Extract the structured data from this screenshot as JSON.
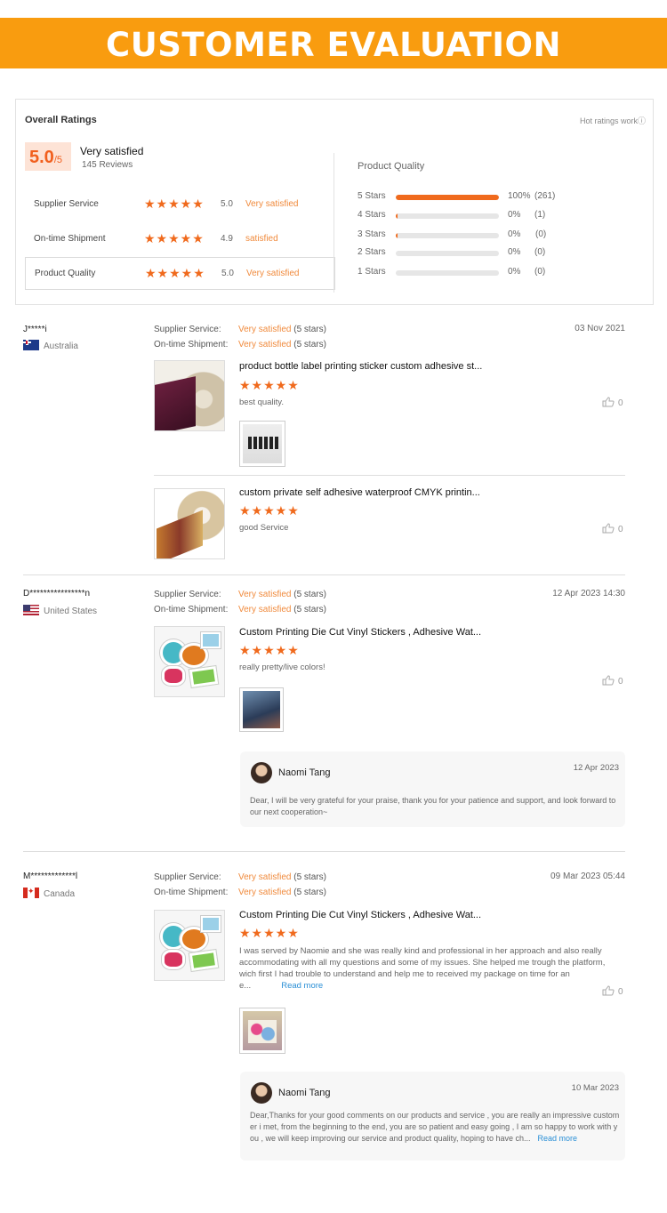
{
  "banner": {
    "title": "CUSTOMER EVALUATION"
  },
  "summary": {
    "overall_label": "Overall Ratings",
    "hot_label": "Hot ratings work",
    "score": "5.0",
    "score_max": "/5",
    "satisfaction": "Very satisfied",
    "reviews": "145 Reviews",
    "stars": "★★★★★",
    "ratings": [
      {
        "label": "Supplier Service",
        "value": "5.0",
        "text": "Very satisfied"
      },
      {
        "label": "On-time Shipment",
        "value": "4.9",
        "text": "satisfied"
      },
      {
        "label": "Product Quality",
        "value": "5.0",
        "text": "Very satisfied"
      }
    ],
    "quality": {
      "title": "Product Quality",
      "bars": [
        {
          "label": "5 Stars",
          "pct": "100%",
          "count": "(261)",
          "fill": 1.0
        },
        {
          "label": "4 Stars",
          "pct": "0%",
          "count": "(1)",
          "fill": 0.02
        },
        {
          "label": "3 Stars",
          "pct": "0%",
          "count": "(0)",
          "fill": 0.02
        },
        {
          "label": "2 Stars",
          "pct": "0%",
          "count": "(0)",
          "fill": 0
        },
        {
          "label": "1 Stars",
          "pct": "0%",
          "count": "(0)",
          "fill": 0
        }
      ]
    }
  },
  "labels": {
    "supplier_service": "Supplier Service:",
    "ontime_shipment": "On-time Shipment:",
    "very_satisfied": "Very satisfied",
    "five_stars": " (5 stars)",
    "stars": "★★★★★",
    "read_more": "Read more"
  },
  "reviews": [
    {
      "name": "J*****i",
      "country": "Australia",
      "date": "03 Nov 2021",
      "products": [
        {
          "title": "product bottle label printing sticker custom adhesive st...",
          "comment": "best quality.",
          "likes": "0"
        },
        {
          "title": "custom private self adhesive waterproof CMYK printin...",
          "comment": "good Service",
          "likes": "0"
        }
      ]
    },
    {
      "name": "D****************n",
      "country": "United States",
      "date": "12 Apr 2023 14:30",
      "products": [
        {
          "title": "Custom Printing Die Cut Vinyl Stickers , Adhesive Wat...",
          "comment": "really pretty/live colors!",
          "likes": "0"
        }
      ],
      "reply": {
        "name": "Naomi Tang",
        "date": "12 Apr 2023",
        "text": "Dear, I will be very grateful for your praise, thank you for your patience and support, and look forward to our next cooperation~"
      }
    },
    {
      "name": "M*************l",
      "country": "Canada",
      "date": "09 Mar 2023 05:44",
      "products": [
        {
          "title": "Custom Printing Die Cut Vinyl Stickers , Adhesive Wat...",
          "comment": "I was served by Naomie and she was really kind and professional in her approach and also really accommodating with all my questions  and some of my issues. She helped me trough the platform, wich first I had trouble to understand and help me to received my package on time for an e...",
          "likes": "0"
        }
      ],
      "reply": {
        "name": "Naomi Tang",
        "date": "10 Mar 2023",
        "text": "Dear,Thanks for your good comments on our products and service ,  you are really an impressive customer i met, from the beginning to the end, you are so patient and easy going , I am so happy to work with you ,  we will keep improving our service and product quality, hoping to have ch..."
      }
    }
  ]
}
